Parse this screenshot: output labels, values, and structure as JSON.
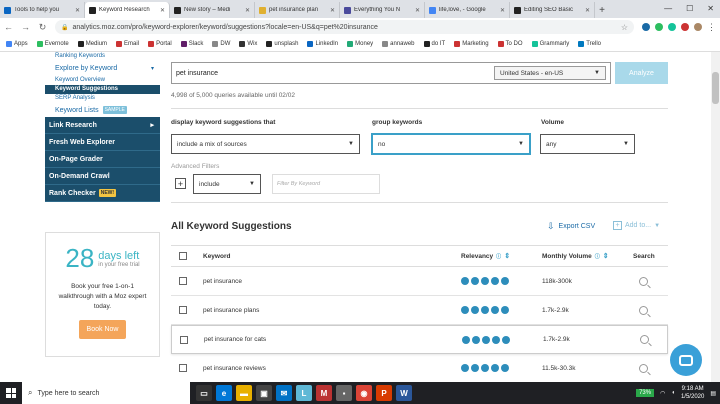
{
  "tabs": [
    {
      "title": "Tools to help you",
      "color": "#0a66c2",
      "active": false
    },
    {
      "title": "Keyword Research",
      "color": "#222",
      "active": true
    },
    {
      "title": "New story – Medi",
      "color": "#222",
      "active": false
    },
    {
      "title": "pet insurance plan",
      "color": "#e0b030",
      "active": false
    },
    {
      "title": "Everything You N",
      "color": "#4a4a9c",
      "active": false
    },
    {
      "title": "life,love, - Google",
      "color": "#4285f4",
      "active": false
    },
    {
      "title": "Editing SEO Basic",
      "color": "#222",
      "active": false
    }
  ],
  "window_controls": {
    "minimize": "—",
    "maximize": "☐",
    "close": "✕"
  },
  "address": {
    "url": "analytics.moz.com/pro/keyword-explorer/keyword/suggestions?locale=en-US&q=pet%20insurance"
  },
  "bookmarks": [
    {
      "label": "Apps",
      "color": "#4285f4"
    },
    {
      "label": "Evernote",
      "color": "#2dbe60"
    },
    {
      "label": "Medium",
      "color": "#222"
    },
    {
      "label": "Email",
      "color": "#c33"
    },
    {
      "label": "Portal",
      "color": "#c33"
    },
    {
      "label": "Slack",
      "color": "#611f69"
    },
    {
      "label": "DW",
      "color": "#888"
    },
    {
      "label": "Wix",
      "color": "#333"
    },
    {
      "label": "unsplash",
      "color": "#222"
    },
    {
      "label": "LinkedIn",
      "color": "#0a66c2"
    },
    {
      "label": "Money",
      "color": "#2a7"
    },
    {
      "label": "annaweb",
      "color": "#888"
    },
    {
      "label": "do IT",
      "color": "#222"
    },
    {
      "label": "Marketing",
      "color": "#c33"
    },
    {
      "label": "To DO",
      "color": "#c33"
    },
    {
      "label": "Grammarly",
      "color": "#15c39a"
    },
    {
      "label": "Trello",
      "color": "#0079bf"
    }
  ],
  "sidebar": {
    "ranking_keywords": "Ranking Keywords",
    "explore_by_keyword": "Explore by Keyword",
    "keyword_overview": "Keyword Overview",
    "keyword_suggestions": "Keyword Suggestions",
    "serp_analysis": "SERP Analysis",
    "keyword_lists": "Keyword Lists",
    "sample_badge": "SAMPLE",
    "nav": [
      "Link Research",
      "Fresh Web Explorer",
      "On-Page Grader",
      "On-Demand Crawl",
      "Rank Checker"
    ],
    "new_badge": "NEW!"
  },
  "trial": {
    "days": "28",
    "days_left": "days left",
    "in_trial": "in your free trial",
    "text": "Book your free 1-on-1 walkthrough with a Moz expert today.",
    "button": "Book Now"
  },
  "search": {
    "query": "pet insurance",
    "country": "United States - en-US",
    "analyze": "Analyze",
    "quota": "4,998 of 5,000 queries available until 02/02"
  },
  "filters": {
    "display_label": "display keyword suggestions that",
    "display_value": "include a mix of sources",
    "group_label": "group keywords",
    "group_value": "no",
    "volume_label": "Volume",
    "volume_value": "any",
    "advanced": "Advanced Filters",
    "include_value": "include",
    "filter_placeholder": "Filter By Keyword"
  },
  "results": {
    "title": "All Keyword Suggestions",
    "export": "Export CSV",
    "add_to": "Add to...",
    "headers": {
      "keyword": "Keyword",
      "relevancy": "Relevancy",
      "volume": "Monthly Volume",
      "search": "Search"
    },
    "rows": [
      {
        "keyword": "pet insurance",
        "relevancy_dots": 5,
        "volume": "118k-300k"
      },
      {
        "keyword": "pet insurance plans",
        "relevancy_dots": 5,
        "volume": "1.7k-2.9k"
      },
      {
        "keyword": "pet insurance for cats",
        "relevancy_dots": 5,
        "volume": "1.7k-2.9k"
      },
      {
        "keyword": "pet insurance reviews",
        "relevancy_dots": 5,
        "volume": "11.5k-30.3k"
      }
    ]
  },
  "taskbar": {
    "search_placeholder": "Type here to search",
    "battery": "73%",
    "time": "9:18 AM",
    "date": "1/5/2020"
  }
}
